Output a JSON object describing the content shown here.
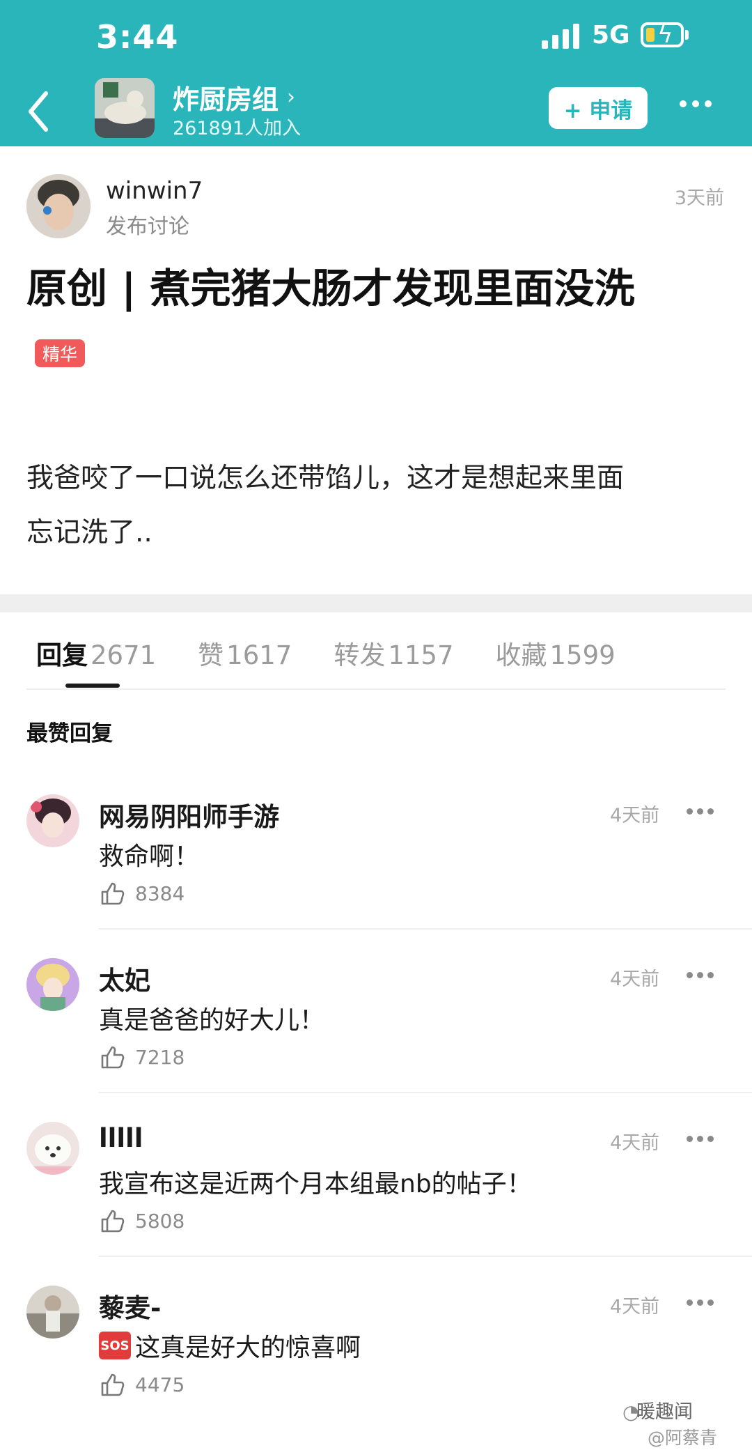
{
  "status_bar": {
    "time": "3:44",
    "network": "5G"
  },
  "group": {
    "name": "炸厨房组",
    "members": "261891人加入",
    "apply_label": "+ 申请"
  },
  "post": {
    "author": "winwin7",
    "author_sub": "发布讨论",
    "time": "3天前",
    "title": "原创 | 煮完猪大肠才发现里面没洗",
    "badge": "精华",
    "body_line1": "我爸咬了一口说怎么还带馅儿，这才是想起来里面",
    "body_line2": "忘记洗了.."
  },
  "tabs": [
    {
      "label": "回复",
      "count": "2671"
    },
    {
      "label": "赞",
      "count": "1617"
    },
    {
      "label": "转发",
      "count": "1157"
    },
    {
      "label": "收藏",
      "count": "1599"
    }
  ],
  "section_label": "最赞回复",
  "comments": [
    {
      "name": "网易阴阳师手游",
      "time": "4天前",
      "text": "救命啊！",
      "likes": "8384"
    },
    {
      "name": "太妃",
      "time": "4天前",
      "text": "真是爸爸的好大儿！",
      "likes": "7218"
    },
    {
      "name": "lllll",
      "time": "4天前",
      "text": "我宣布这是近两个月本组最nb的帖子！",
      "likes": "5808"
    },
    {
      "name": "藜麦-",
      "time": "4天前",
      "text": "这真是好大的惊喜啊",
      "likes": "4475",
      "emoji": "SOS"
    }
  ],
  "watermark": {
    "line1": "暖趣闻",
    "line2": "@阿蔡青"
  },
  "colors": {
    "accent": "#2ab5bb",
    "badge": "#f05a5a"
  },
  "icons": [
    "back-icon",
    "chevron-right-icon",
    "more-icon",
    "thumbs-up-icon",
    "sos-emoji"
  ]
}
